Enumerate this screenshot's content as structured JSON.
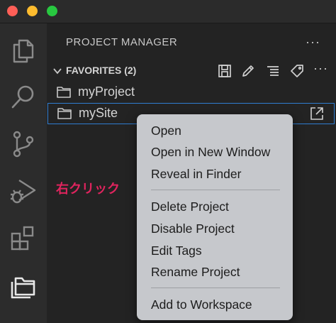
{
  "window": {
    "controls": [
      "close",
      "minimize",
      "zoom"
    ]
  },
  "activity_bar": {
    "items": [
      {
        "icon": "files-icon"
      },
      {
        "icon": "search-icon"
      },
      {
        "icon": "source-control-icon"
      },
      {
        "icon": "run-debug-icon"
      },
      {
        "icon": "extensions-icon"
      },
      {
        "icon": "project-manager-icon"
      }
    ]
  },
  "sidebar": {
    "title": "PROJECT MANAGER",
    "more": "···",
    "favorites": {
      "label": "FAVORITES (2)",
      "actions": [
        "save-icon",
        "edit-icon",
        "filter-icon",
        "tag-icon",
        "more-icon"
      ],
      "more": "···",
      "items": [
        {
          "label": "myProject",
          "selected": false
        },
        {
          "label": "mySite",
          "selected": true
        }
      ]
    }
  },
  "annotation": {
    "text": "右クリック",
    "color": "#e0245e"
  },
  "context_menu": {
    "groups": [
      [
        "Open",
        "Open in New Window",
        "Reveal in Finder"
      ],
      [
        "Delete Project",
        "Disable Project",
        "Edit Tags",
        "Rename Project"
      ],
      [
        "Add to Workspace"
      ]
    ]
  }
}
